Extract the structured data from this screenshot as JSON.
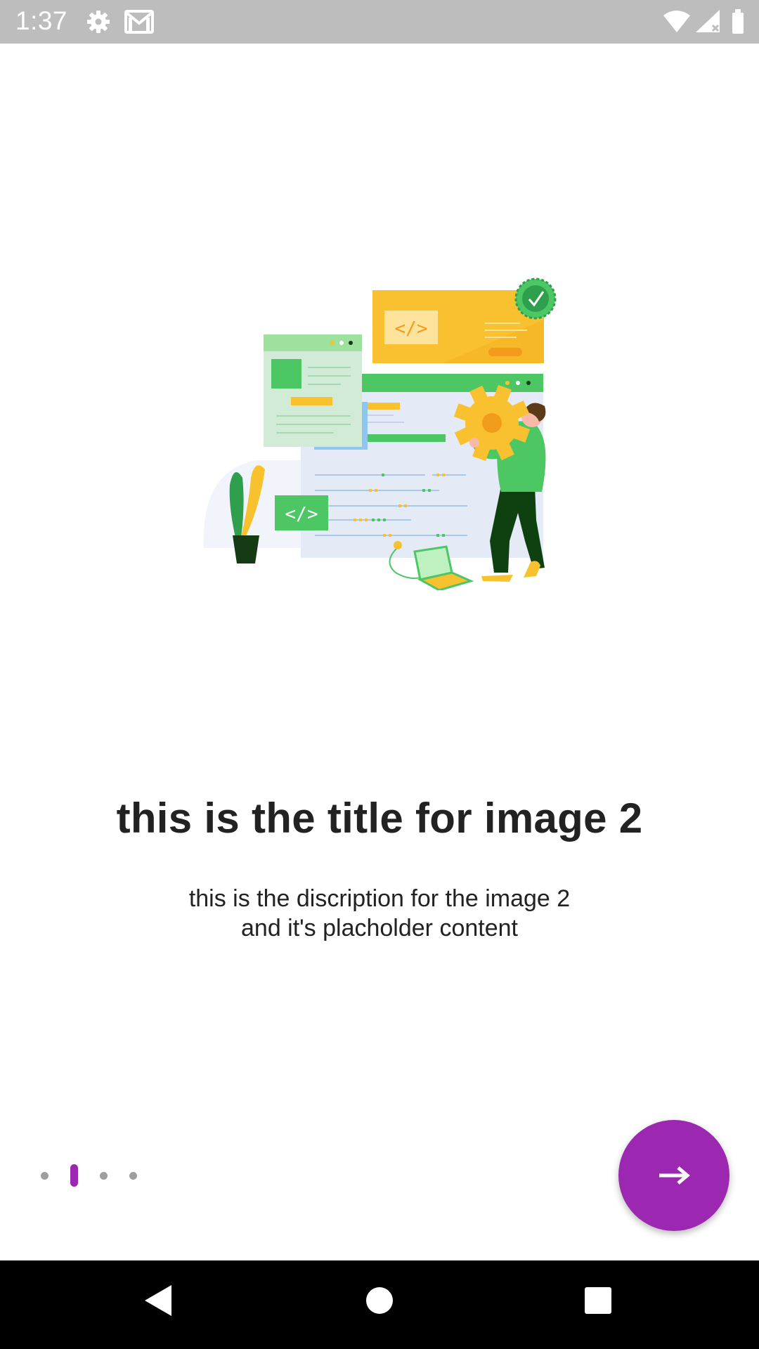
{
  "status_bar": {
    "time": "1:37",
    "icons_left": [
      "settings-icon",
      "gmail-icon"
    ],
    "icons_right": [
      "wifi-icon",
      "cell-signal-icon",
      "battery-icon"
    ]
  },
  "onboarding": {
    "illustration": "developer-coding-illustration",
    "title": "this is the title for image 2",
    "description_line1": "this is the discription for the image 2",
    "description_line2": "and it's placholder content",
    "page_count": 4,
    "current_page": 2
  },
  "next_button": {
    "icon": "arrow-right-icon",
    "color": "#9c27b0"
  },
  "nav_bar": {
    "buttons": [
      "back-icon",
      "home-icon",
      "recents-icon"
    ]
  },
  "colors": {
    "accent": "#9c27b0",
    "status_bar": "#bdbdbd",
    "inactive_dot": "#9e9e9e"
  }
}
